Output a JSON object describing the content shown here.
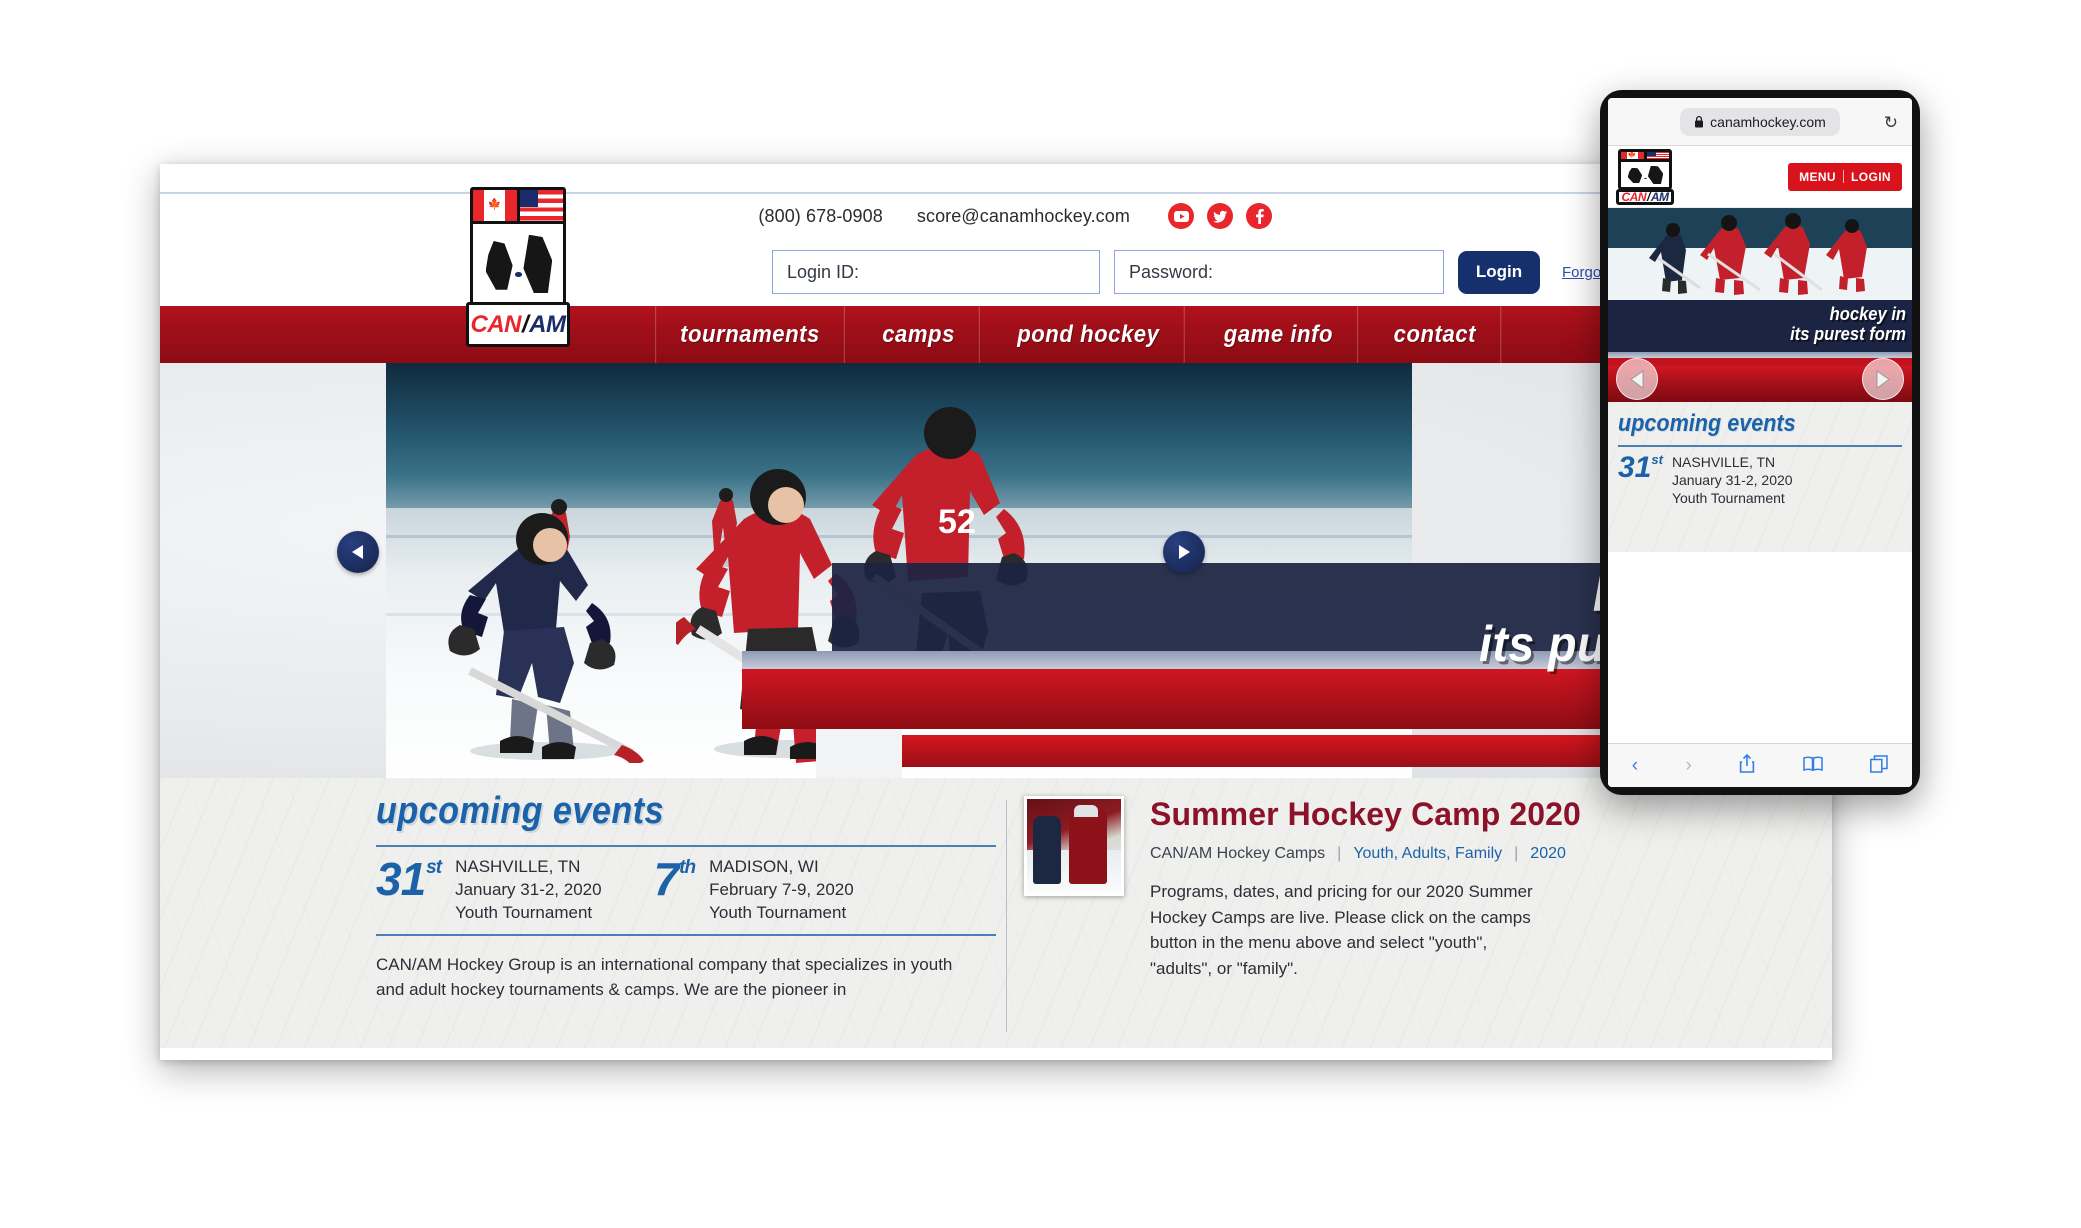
{
  "site": {
    "topbar": {
      "phone": "(800) 678-0908",
      "email": "score@canamhockey.com",
      "social": [
        "youtube-icon",
        "twitter-icon",
        "facebook-icon"
      ]
    },
    "login": {
      "login_id_label": "Login ID:",
      "login_id_value": "",
      "password_label": "Password:",
      "password_value": "",
      "login_button": "Login",
      "forgot_link": "Forgot your password?"
    },
    "nav": [
      {
        "label": "tournaments"
      },
      {
        "label": "camps"
      },
      {
        "label": "pond hockey"
      },
      {
        "label": "game info"
      },
      {
        "label": "contact"
      }
    ],
    "logo": {
      "can": "CAN",
      "slash": "/",
      "am": "AM"
    },
    "hero": {
      "title_line1": "hockey in",
      "title_line2": "its purest form",
      "prev_icon": "chevron-left-icon",
      "next_icon": "chevron-right-icon"
    },
    "events": {
      "heading": "upcoming events",
      "items": [
        {
          "day": "31",
          "suffix": "st",
          "city": "NASHVILLE, TN",
          "dates": "January 31-2, 2020",
          "type": "Youth Tournament"
        },
        {
          "day": "7",
          "suffix": "th",
          "city": "MADISON, WI",
          "dates": "February 7-9, 2020",
          "type": "Youth Tournament"
        }
      ],
      "blurb": "CAN/AM Hockey Group is an international company that specializes in youth and adult hockey tournaments & camps. We are the pioneer in"
    },
    "feature": {
      "title": "Summer Hockey Camp 2020",
      "meta_category": "CAN/AM Hockey Camps",
      "meta_audience": "Youth, Adults, Family",
      "meta_year": "2020",
      "body": "Programs, dates, and pricing for our 2020 Summer Hockey Camps are live. Please click on the camps button in the menu above and select \"youth\", \"adults\", or \"family\"."
    }
  },
  "phone": {
    "url": "canamhockey.com",
    "lock_icon": "lock-icon",
    "reload_icon": "reload-icon",
    "menu_label": "MENU",
    "login_label": "LOGIN",
    "hero_line1": "hockey in",
    "hero_line2": "its purest form",
    "prev_icon": "chevron-left-icon",
    "next_icon": "chevron-right-icon",
    "events_heading": "upcoming events",
    "event": {
      "day": "31",
      "suffix": "st",
      "city": "NASHVILLE, TN",
      "dates": "January 31-2, 2020",
      "type": "Youth Tournament"
    },
    "toolbar": [
      "back-icon",
      "forward-icon",
      "share-icon",
      "bookmarks-icon",
      "tabs-icon"
    ]
  },
  "colors": {
    "brand_red": "#b1121d",
    "brand_navy": "#15306d",
    "link_blue": "#1c62a8",
    "maroon": "#8b1229",
    "social_red": "#e8262b"
  }
}
